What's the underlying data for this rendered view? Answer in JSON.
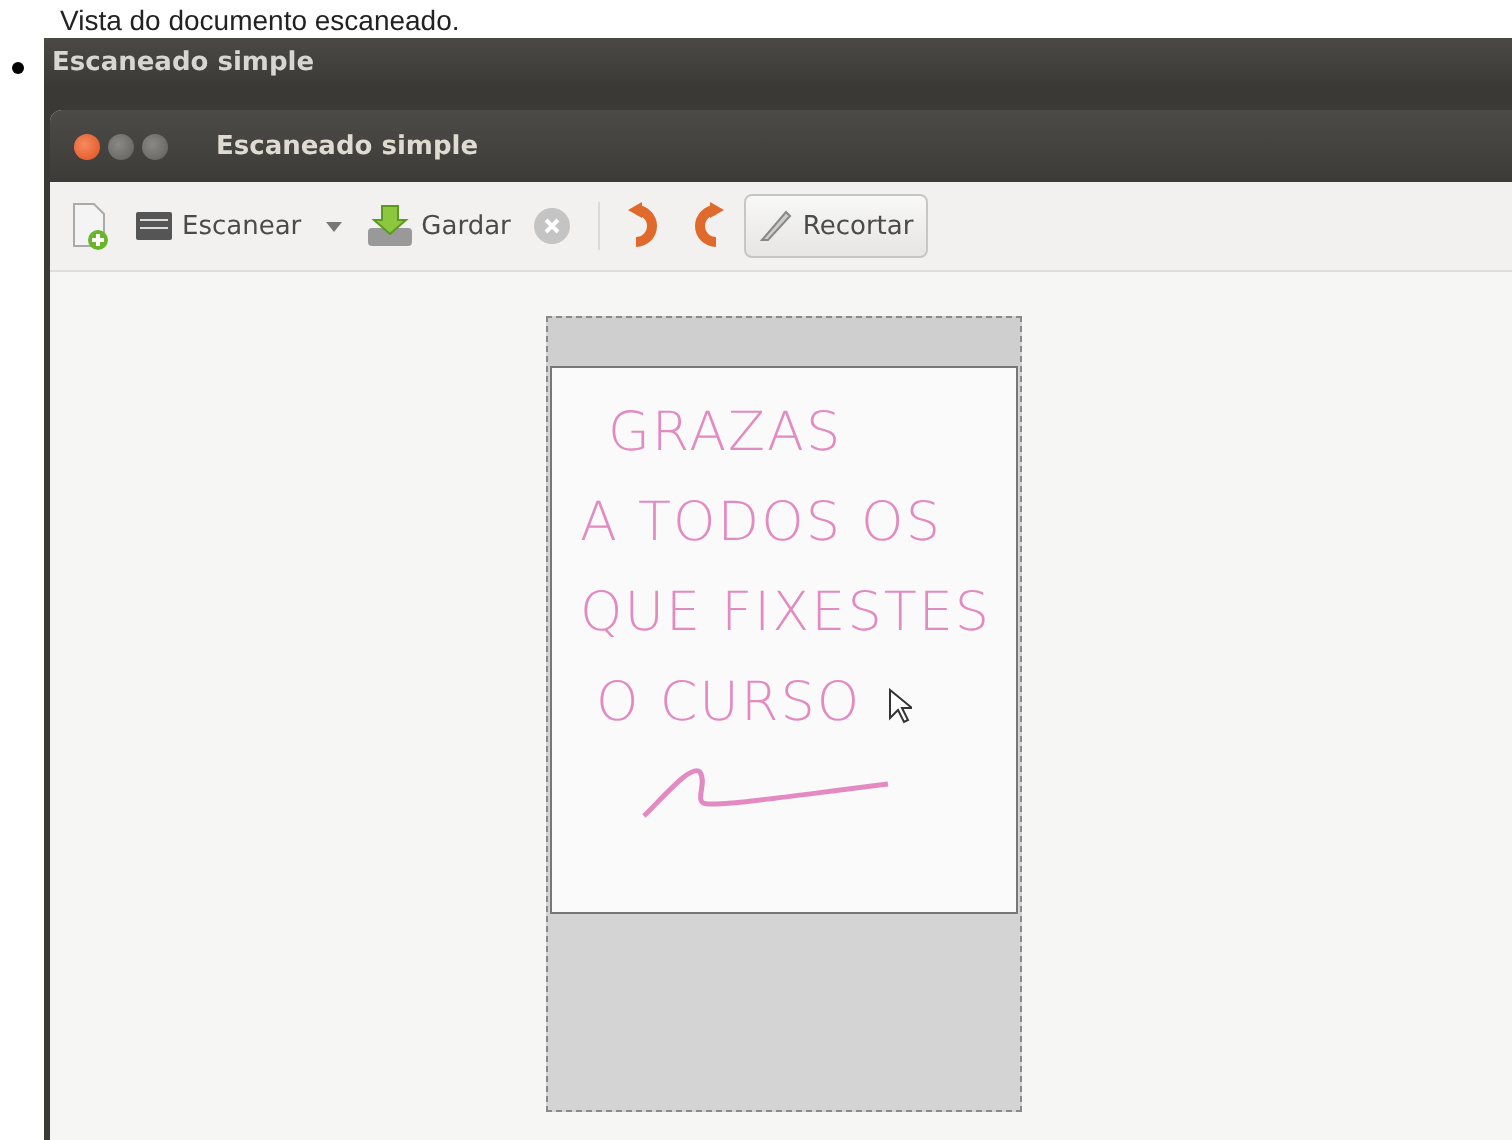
{
  "caption": "Vista do documento escaneado.",
  "outer_window": {
    "title": "Escaneado simple"
  },
  "window": {
    "title": "Escaneado simple"
  },
  "toolbar": [
    {
      "kind": "new"
    },
    {
      "kind": "scan",
      "label": "Escanear"
    },
    {
      "kind": "dropdown"
    },
    {
      "kind": "save",
      "label": "Gardar"
    },
    {
      "kind": "stop"
    },
    {
      "kind": "rotate-left"
    },
    {
      "kind": "rotate-right"
    },
    {
      "kind": "crop",
      "label": "Recortar"
    }
  ],
  "document": {
    "lines": [
      "GRAZAS",
      "A TODOS OS",
      "QUE FIXESTES",
      "O CURSO"
    ]
  }
}
